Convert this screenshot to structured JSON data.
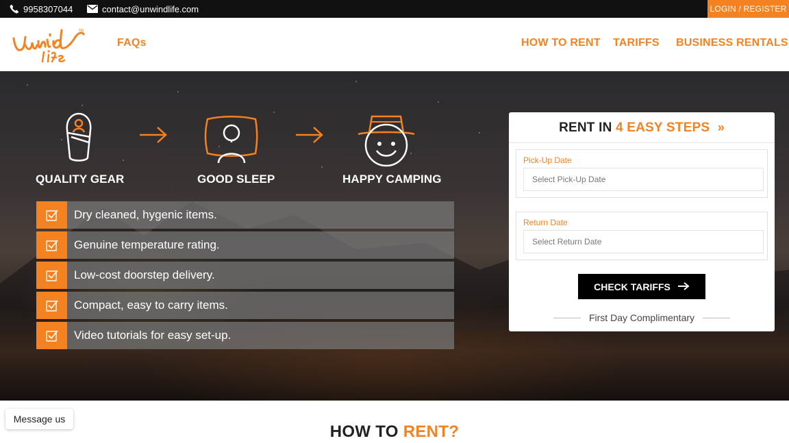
{
  "topbar": {
    "phone": "9958307044",
    "email": "contact@unwindlife.com",
    "login_label": "LOGIN / REGISTER",
    "phone_icon": "phone-icon",
    "email_icon": "envelope-icon"
  },
  "nav": {
    "logo_text": "Unwind Life",
    "faq": "FAQs",
    "how_to_rent": "HOW TO RENT",
    "tariffs": "TARIFFS",
    "business_rentals": "BUSINESS RENTALS"
  },
  "hero": {
    "features": [
      {
        "label": "QUALITY GEAR",
        "icon": "sleeping-bag-icon"
      },
      {
        "label": "GOOD SLEEP",
        "icon": "pillow-person-icon"
      },
      {
        "label": "HAPPY CAMPING",
        "icon": "smiley-hat-icon"
      }
    ],
    "benefits": [
      "Dry cleaned, hygenic items.",
      "Genuine temperature rating.",
      "Low-cost doorstep delivery.",
      "Compact, easy to carry items.",
      "Video tutorials for easy set-up."
    ]
  },
  "rent": {
    "title_prefix": "RENT IN",
    "title_highlight": "4 EASY STEPS",
    "title_suffix": "»",
    "pickup_label": "Pick-Up Date",
    "pickup_placeholder": "Select Pick-Up Date",
    "return_label": "Return Date",
    "return_placeholder": "Select Return Date",
    "button_label": "CHECK TARIFFS",
    "note": "First Day Complimentary"
  },
  "footer": {
    "message_us": "Message us",
    "section_title_prefix": "HOW TO",
    "section_title_highlight": "RENT?"
  },
  "colors": {
    "accent": "#f58220",
    "topbar": "#111111",
    "button": "#000000"
  }
}
